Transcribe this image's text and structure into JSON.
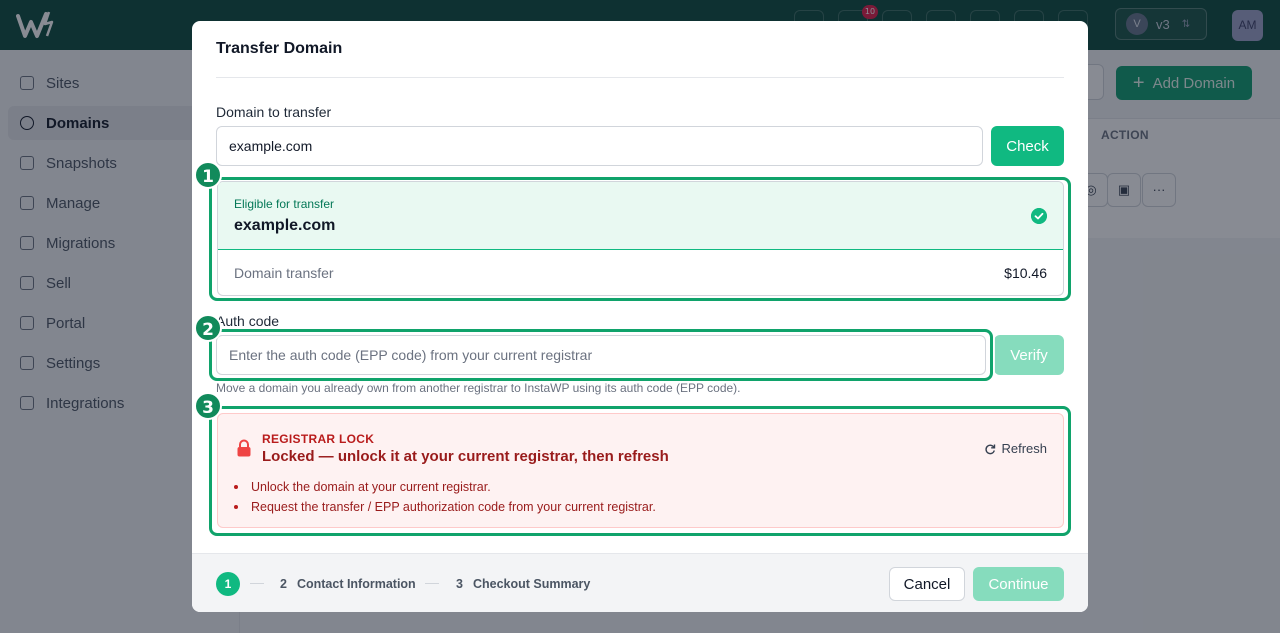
{
  "app": {
    "notification_count": "10",
    "version_avatar": "V",
    "version_label": "v3",
    "user_initials": "AM"
  },
  "sidebar": {
    "items": [
      {
        "label": "Sites",
        "icon": "sites-icon"
      },
      {
        "label": "Domains",
        "icon": "globe-icon",
        "active": true
      },
      {
        "label": "Snapshots",
        "icon": "snapshots-icon"
      },
      {
        "label": "Manage",
        "icon": "manage-icon"
      },
      {
        "label": "Migrations",
        "icon": "migrations-icon"
      },
      {
        "label": "Sell",
        "icon": "tag-icon"
      },
      {
        "label": "Portal",
        "icon": "portal-icon"
      },
      {
        "label": "Settings",
        "icon": "gear-icon"
      },
      {
        "label": "Integrations",
        "icon": "puzzle-icon"
      }
    ]
  },
  "main": {
    "add_domain_label": "Add Domain",
    "table_action_header": "ACTION"
  },
  "modal": {
    "title": "Transfer Domain",
    "domain_label": "Domain to transfer",
    "domain_value": "example.com",
    "check_label": "Check",
    "eligibility": {
      "status": "Eligible for transfer",
      "domain": "example.com",
      "row_label": "Domain transfer",
      "row_price": "$10.46"
    },
    "auth": {
      "label": "Auth code",
      "placeholder": "Enter the auth code (EPP code) from your current registrar",
      "verify_label": "Verify",
      "helper": "Move a domain you already own from another registrar to InstaWP using its auth code (EPP code)."
    },
    "lock": {
      "kicker": "REGISTRAR LOCK",
      "title": "Locked — unlock it at your current registrar, then refresh",
      "refresh_label": "Refresh",
      "steps": [
        "Unlock the domain at your current registrar.",
        "Request the transfer / EPP authorization code from your current registrar."
      ]
    },
    "footer": {
      "steps": [
        {
          "num": "1",
          "label": ""
        },
        {
          "num": "2",
          "label": "Contact Information"
        },
        {
          "num": "3",
          "label": "Checkout Summary"
        }
      ],
      "cancel_label": "Cancel",
      "continue_label": "Continue"
    }
  },
  "annotations": [
    "1",
    "2",
    "3"
  ],
  "colors": {
    "brand_dark": "#0b4a3c",
    "accent": "#10b981",
    "highlight": "#10a36b",
    "danger": "#b91c1c"
  }
}
